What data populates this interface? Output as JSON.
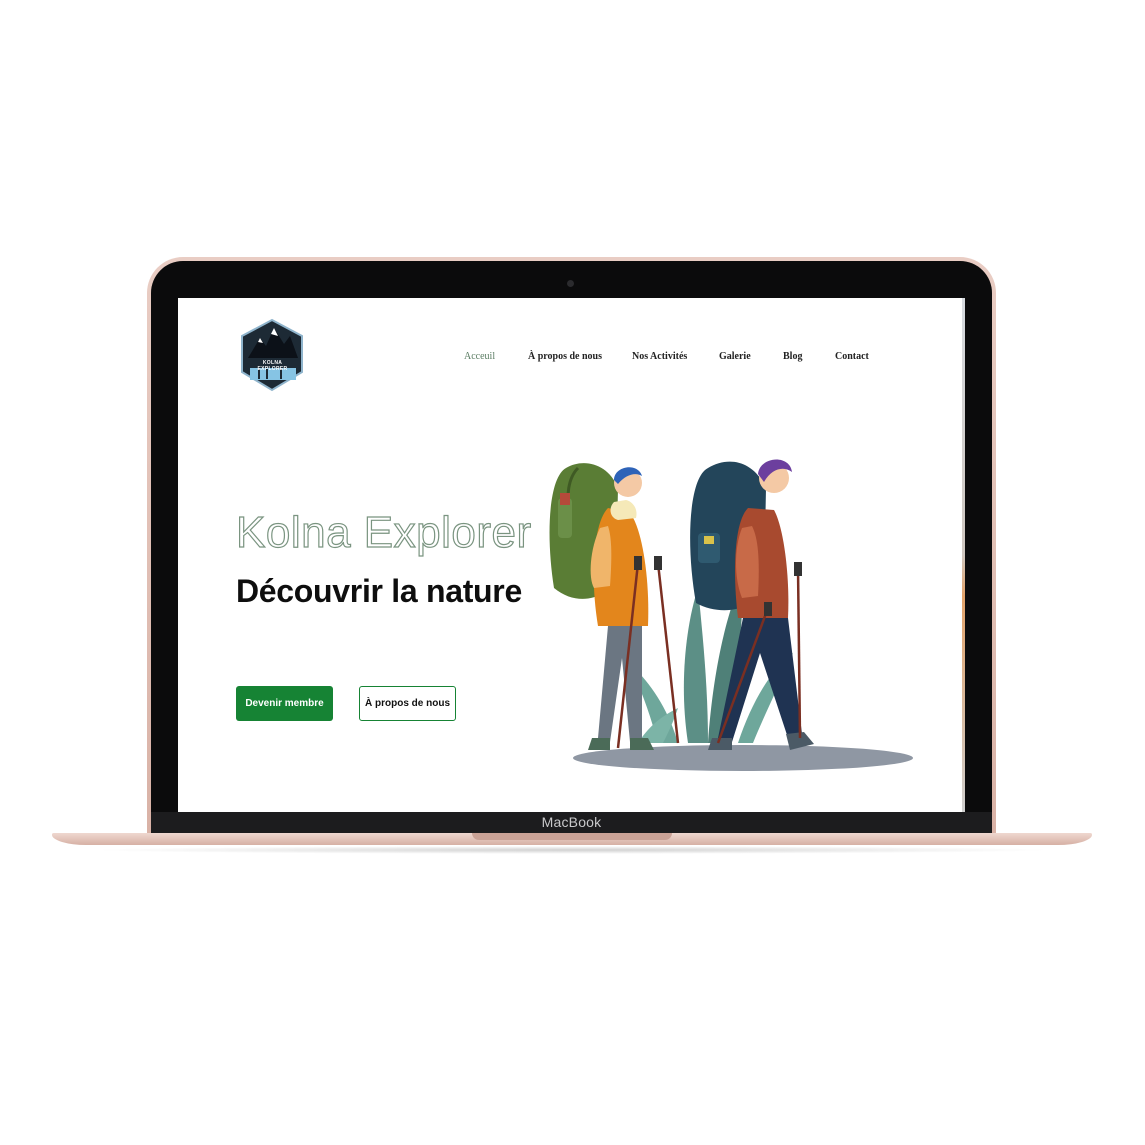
{
  "device": {
    "brand": "MacBook"
  },
  "site": {
    "logo_text": "KOLNA EXPLORER",
    "nav": [
      {
        "label": "Acceuil",
        "active": true
      },
      {
        "label": "À propos de nous",
        "active": false
      },
      {
        "label": "Nos Activités",
        "active": false
      },
      {
        "label": "Galerie",
        "active": false
      },
      {
        "label": "Blog",
        "active": false
      },
      {
        "label": "Contact",
        "active": false
      }
    ],
    "hero": {
      "title": "Kolna Explorer",
      "subtitle": "Découvrir la nature",
      "primary_button": "Devenir membre",
      "secondary_button": "À propos de nous"
    }
  },
  "colors": {
    "accent_green": "#168334",
    "nav_active": "#5b7d63",
    "title_outline": "#7a9480"
  }
}
